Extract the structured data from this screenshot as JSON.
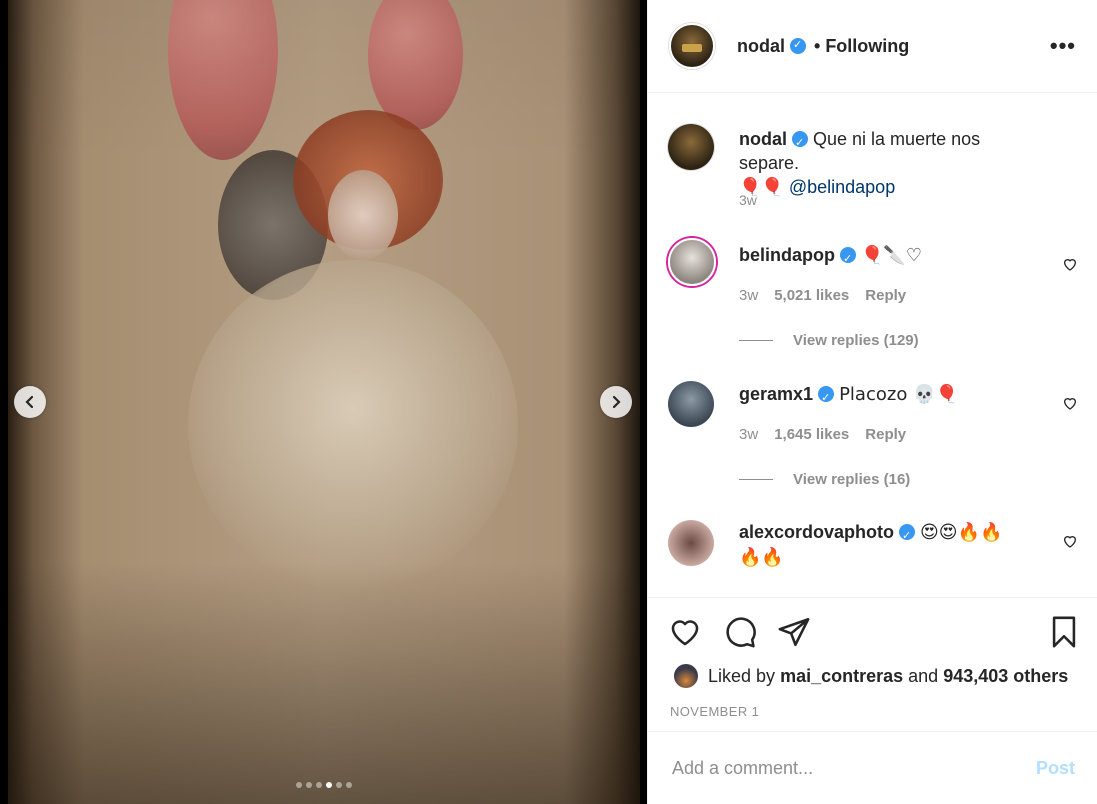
{
  "post": {
    "username": "nodal",
    "follow_status": "Following",
    "more_label": "•••",
    "carousel": {
      "total": 6,
      "active_index": 3
    }
  },
  "caption": {
    "username": "nodal",
    "text": "Que ni la muerte nos separe.",
    "emoji": "🎈🎈",
    "mention": "@belindapop",
    "time": "3w"
  },
  "comments": [
    {
      "username": "belindapop",
      "text": "🎈🔪♡",
      "time": "3w",
      "likes": "5,021 likes",
      "reply": "Reply",
      "view_replies": "View replies (129)"
    },
    {
      "username": "geramx1",
      "text": "Placozo 💀🎈",
      "time": "3w",
      "likes": "1,645 likes",
      "reply": "Reply",
      "view_replies": "View replies (16)"
    },
    {
      "username": "alexcordovaphoto",
      "text": "😍😍🔥🔥",
      "text2": "🔥🔥"
    }
  ],
  "actions": {
    "liked_prefix": "Liked by",
    "liked_user": "mai_contreras",
    "liked_mid": "and",
    "liked_count": "943,403 others",
    "date": "NOVEMBER 1"
  },
  "composer": {
    "placeholder": "Add a comment...",
    "post_label": "Post"
  },
  "colors": {
    "verified": "#3897f0",
    "link": "#00376b",
    "post_disabled": "#b2dffc"
  }
}
